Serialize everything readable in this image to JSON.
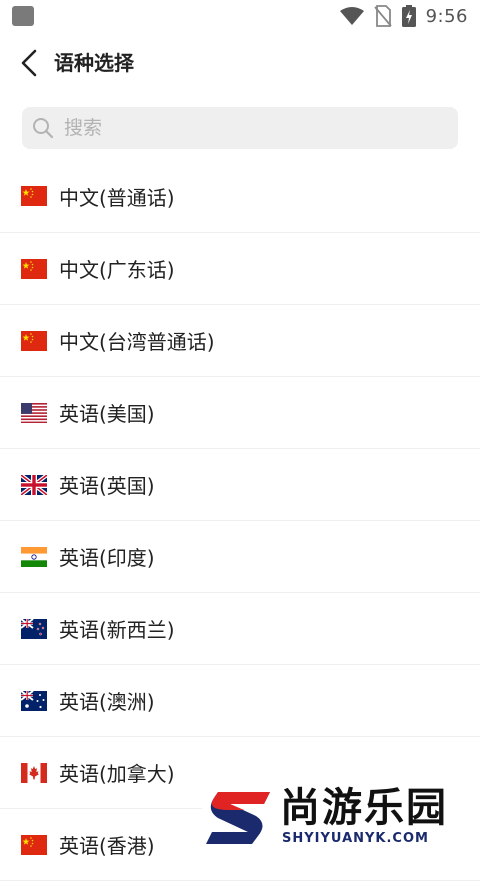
{
  "status_bar": {
    "time": "9:56",
    "icons": [
      "wifi-icon",
      "no-sim-icon",
      "battery-charging-icon"
    ]
  },
  "header": {
    "title": "语种选择",
    "back_icon": "chevron-left-icon"
  },
  "search": {
    "placeholder": "搜索",
    "value": "",
    "icon": "search-icon"
  },
  "languages": [
    {
      "label": "中文(普通话)",
      "flag": "cn"
    },
    {
      "label": "中文(广东话)",
      "flag": "cn"
    },
    {
      "label": "中文(台湾普通话)",
      "flag": "cn"
    },
    {
      "label": "英语(美国)",
      "flag": "us"
    },
    {
      "label": "英语(英国)",
      "flag": "gb"
    },
    {
      "label": "英语(印度)",
      "flag": "in"
    },
    {
      "label": "英语(新西兰)",
      "flag": "nz"
    },
    {
      "label": "英语(澳洲)",
      "flag": "au"
    },
    {
      "label": "英语(加拿大)",
      "flag": "ca"
    },
    {
      "label": "英语(香港)",
      "flag": "cn"
    }
  ],
  "watermark": {
    "title": "尚游乐园",
    "subtitle": "SHYIYUANYK.COM"
  },
  "colors": {
    "background": "#ffffff",
    "search_bg": "#efefef",
    "divider": "#efefef",
    "text": "#222222",
    "placeholder": "#b3b3b3"
  }
}
